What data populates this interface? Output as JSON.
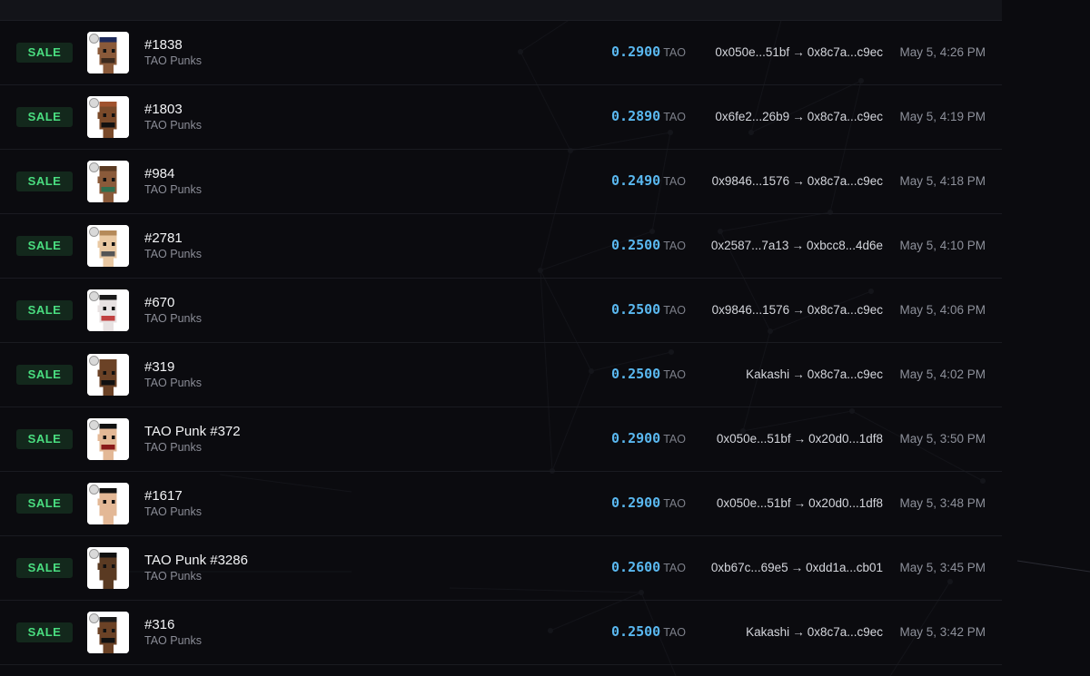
{
  "colors": {
    "background": "#0b0b0f",
    "sale_badge_bg": "#13281c",
    "sale_badge_text": "#4ade80",
    "price": "#5ab8f0",
    "muted": "#8e919b"
  },
  "icons": {
    "arrow": "right-arrow-icon"
  },
  "sales": [
    {
      "badge": "SALE",
      "name": "#1838",
      "collection": "TAO Punks",
      "price": "0.2900",
      "unit": "TAO",
      "from": "0x050e...51bf",
      "arrow": "→",
      "to": "0x8c7a...c9ec",
      "time": "May 5, 4:26 PM",
      "avatar": {
        "skin": "#8a5a3a",
        "hair": "#1e2a5a",
        "extra": "#3c2a1e"
      }
    },
    {
      "badge": "SALE",
      "name": "#1803",
      "collection": "TAO Punks",
      "price": "0.2890",
      "unit": "TAO",
      "from": "0x6fe2...26b9",
      "arrow": "→",
      "to": "0x8c7a...c9ec",
      "time": "May 5, 4:19 PM",
      "avatar": {
        "skin": "#7a4a2a",
        "hair": "#a0522d",
        "extra": "#111111"
      }
    },
    {
      "badge": "SALE",
      "name": "#984",
      "collection": "TAO Punks",
      "price": "0.2490",
      "unit": "TAO",
      "from": "0x9846...1576",
      "arrow": "→",
      "to": "0x8c7a...c9ec",
      "time": "May 5, 4:18 PM",
      "avatar": {
        "skin": "#8a5a3a",
        "hair": "#5a3a22",
        "extra": "#2f6f4f"
      }
    },
    {
      "badge": "SALE",
      "name": "#2781",
      "collection": "TAO Punks",
      "price": "0.2500",
      "unit": "TAO",
      "from": "0x2587...7a13",
      "arrow": "→",
      "to": "0xbcc8...4d6e",
      "time": "May 5, 4:10 PM",
      "avatar": {
        "skin": "#e9c8a2",
        "hair": "#b58a5a",
        "extra": "#555555"
      }
    },
    {
      "badge": "SALE",
      "name": "#670",
      "collection": "TAO Punks",
      "price": "0.2500",
      "unit": "TAO",
      "from": "0x9846...1576",
      "arrow": "→",
      "to": "0x8c7a...c9ec",
      "time": "May 5, 4:06 PM",
      "avatar": {
        "skin": "#e8e2e2",
        "hair": "#1a1a1a",
        "extra": "#c04040"
      }
    },
    {
      "badge": "SALE",
      "name": "#319",
      "collection": "TAO Punks",
      "price": "0.2500",
      "unit": "TAO",
      "from": "Kakashi",
      "arrow": "→",
      "to": "0x8c7a...c9ec",
      "time": "May 5, 4:02 PM",
      "avatar": {
        "skin": "#6b4226",
        "hair": "#6b4226",
        "extra": "#111111"
      }
    },
    {
      "badge": "SALE",
      "name": "TAO Punk #372",
      "collection": "TAO Punks",
      "price": "0.2900",
      "unit": "TAO",
      "from": "0x050e...51bf",
      "arrow": "→",
      "to": "0x20d0...1df8",
      "time": "May 5, 3:50 PM",
      "avatar": {
        "skin": "#e3b896",
        "hair": "#111111",
        "extra": "#8a1a1a"
      }
    },
    {
      "badge": "SALE",
      "name": "#1617",
      "collection": "TAO Punks",
      "price": "0.2900",
      "unit": "TAO",
      "from": "0x050e...51bf",
      "arrow": "→",
      "to": "0x20d0...1df8",
      "time": "May 5, 3:48 PM",
      "avatar": {
        "skin": "#e3b896",
        "hair": "#111111",
        "extra": "#e3b896"
      }
    },
    {
      "badge": "SALE",
      "name": "TAO Punk #3286",
      "collection": "TAO Punks",
      "price": "0.2600",
      "unit": "TAO",
      "from": "0xb67c...69e5",
      "arrow": "→",
      "to": "0xdd1a...cb01",
      "time": "May 5, 3:45 PM",
      "avatar": {
        "skin": "#5a3a22",
        "hair": "#111111",
        "extra": "#5a3a22"
      }
    },
    {
      "badge": "SALE",
      "name": "#316",
      "collection": "TAO Punks",
      "price": "0.2500",
      "unit": "TAO",
      "from": "Kakashi",
      "arrow": "→",
      "to": "0x8c7a...c9ec",
      "time": "May 5, 3:42 PM",
      "avatar": {
        "skin": "#6b4226",
        "hair": "#1a1a1a",
        "extra": "#111111"
      }
    }
  ]
}
